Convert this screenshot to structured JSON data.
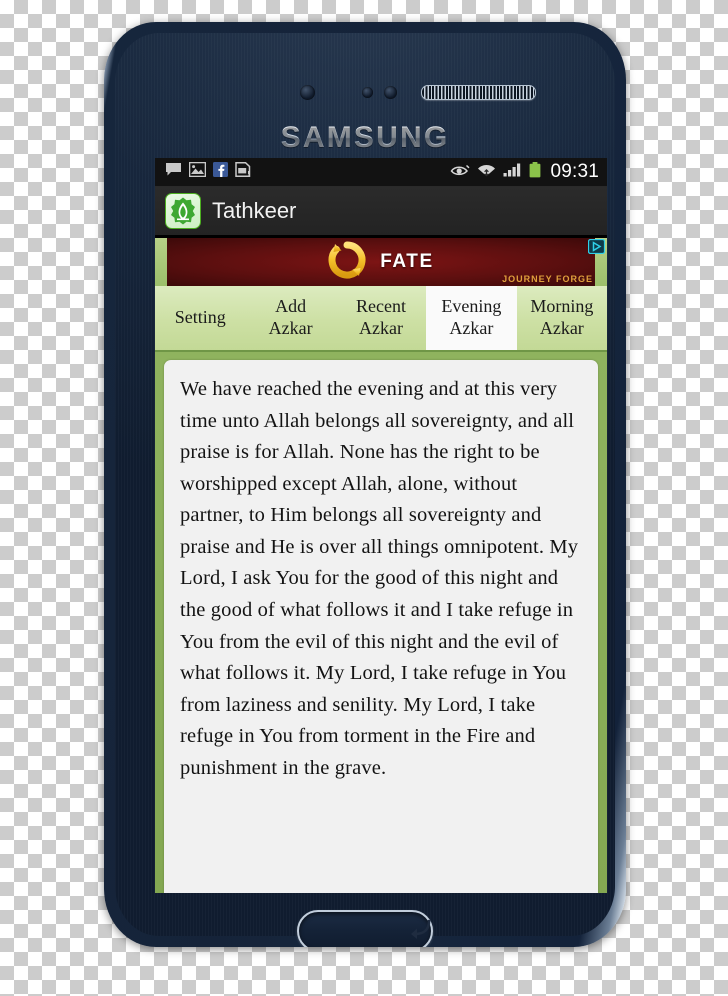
{
  "device": {
    "brand": "SAMSUNG",
    "hardware": {
      "camera": "front-camera",
      "earpiece": "earpiece-speaker",
      "home": "home-button",
      "menu": "menu-key",
      "back": "back-key"
    }
  },
  "status_bar": {
    "clock": "09:31",
    "left_icons": [
      {
        "name": "message-icon"
      },
      {
        "name": "gallery-icon"
      },
      {
        "name": "facebook-icon"
      },
      {
        "name": "sd-card-icon"
      }
    ],
    "right_icons": [
      {
        "name": "smart-stay-eye-icon"
      },
      {
        "name": "wifi-icon"
      },
      {
        "name": "signal-bars-icon"
      },
      {
        "name": "battery-icon"
      }
    ]
  },
  "action_bar": {
    "app_title": "Tathkeer",
    "app_icon": "tathkeer-app-icon"
  },
  "ad": {
    "title": "FATE",
    "sponsor": "JOURNEY FORGE",
    "logo": "fate-ring-logo",
    "adchoices": "adchoices-icon"
  },
  "tabs": [
    {
      "line1": "Setting",
      "line2": "",
      "selected": false
    },
    {
      "line1": "Add",
      "line2": "Azkar",
      "selected": false
    },
    {
      "line1": "Recent",
      "line2": "Azkar",
      "selected": false
    },
    {
      "line1": "Evening",
      "line2": "Azkar",
      "selected": true
    },
    {
      "line1": "Morning",
      "line2": "Azkar",
      "selected": false
    }
  ],
  "content": {
    "azkar_text": "We have reached the evening and at this very time unto Allah belongs all sovereignty, and all praise is for Allah. None has the right to be worshipped except Allah, alone, without partner, to Him belongs all sovereignty and praise and He is over all things omnipotent. My Lord, I ask You for the good of this night and the good of what follows it and I take refuge in You from the evil of this night and the evil of what follows it. My Lord, I take refuge in You from laziness and senility. My Lord, I take refuge in You from torment in the Fire and punishment in the grave."
  },
  "colors": {
    "tab_bg": "#cde0a4",
    "tab_selected_bg": "#fafafa",
    "content_bg": "#8fb35e",
    "card_bg": "#f1f1f1",
    "ad_bg": "#5c0f0f",
    "battery_green": "#8bc34a",
    "bezel": "#152339"
  }
}
